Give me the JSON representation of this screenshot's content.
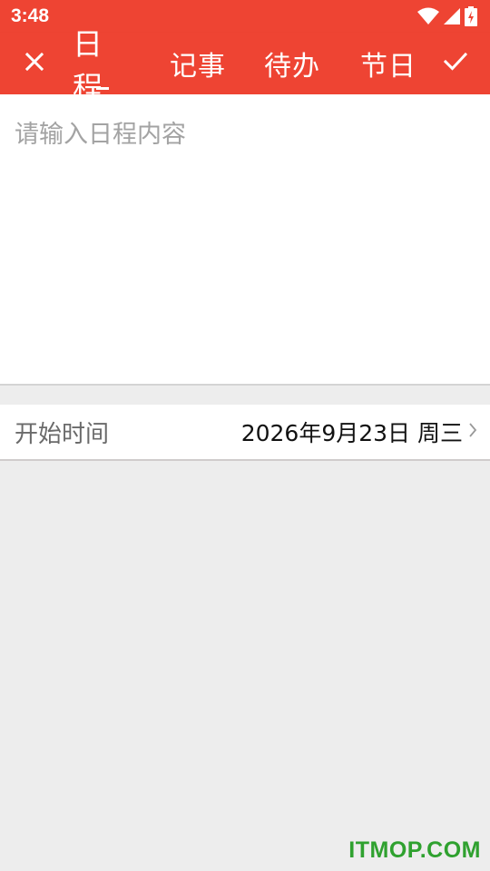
{
  "status_bar": {
    "time": "3:48",
    "icons": [
      "wifi-icon",
      "signal-icon",
      "battery-charging-icon"
    ]
  },
  "toolbar": {
    "close_icon": "close-icon",
    "confirm_icon": "check-icon",
    "tabs": [
      {
        "label": "日程",
        "active": true
      },
      {
        "label": "记事",
        "active": false
      },
      {
        "label": "待办",
        "active": false
      },
      {
        "label": "节日",
        "active": false
      }
    ]
  },
  "content": {
    "placeholder": "请输入日程内容",
    "value": ""
  },
  "start_time": {
    "label": "开始时间",
    "value": "2026年9月23日 周三"
  },
  "watermark": "ITMOP.COM",
  "colors": {
    "primary": "#ee4433",
    "background": "#ededed",
    "watermark": "#2fa12f"
  }
}
